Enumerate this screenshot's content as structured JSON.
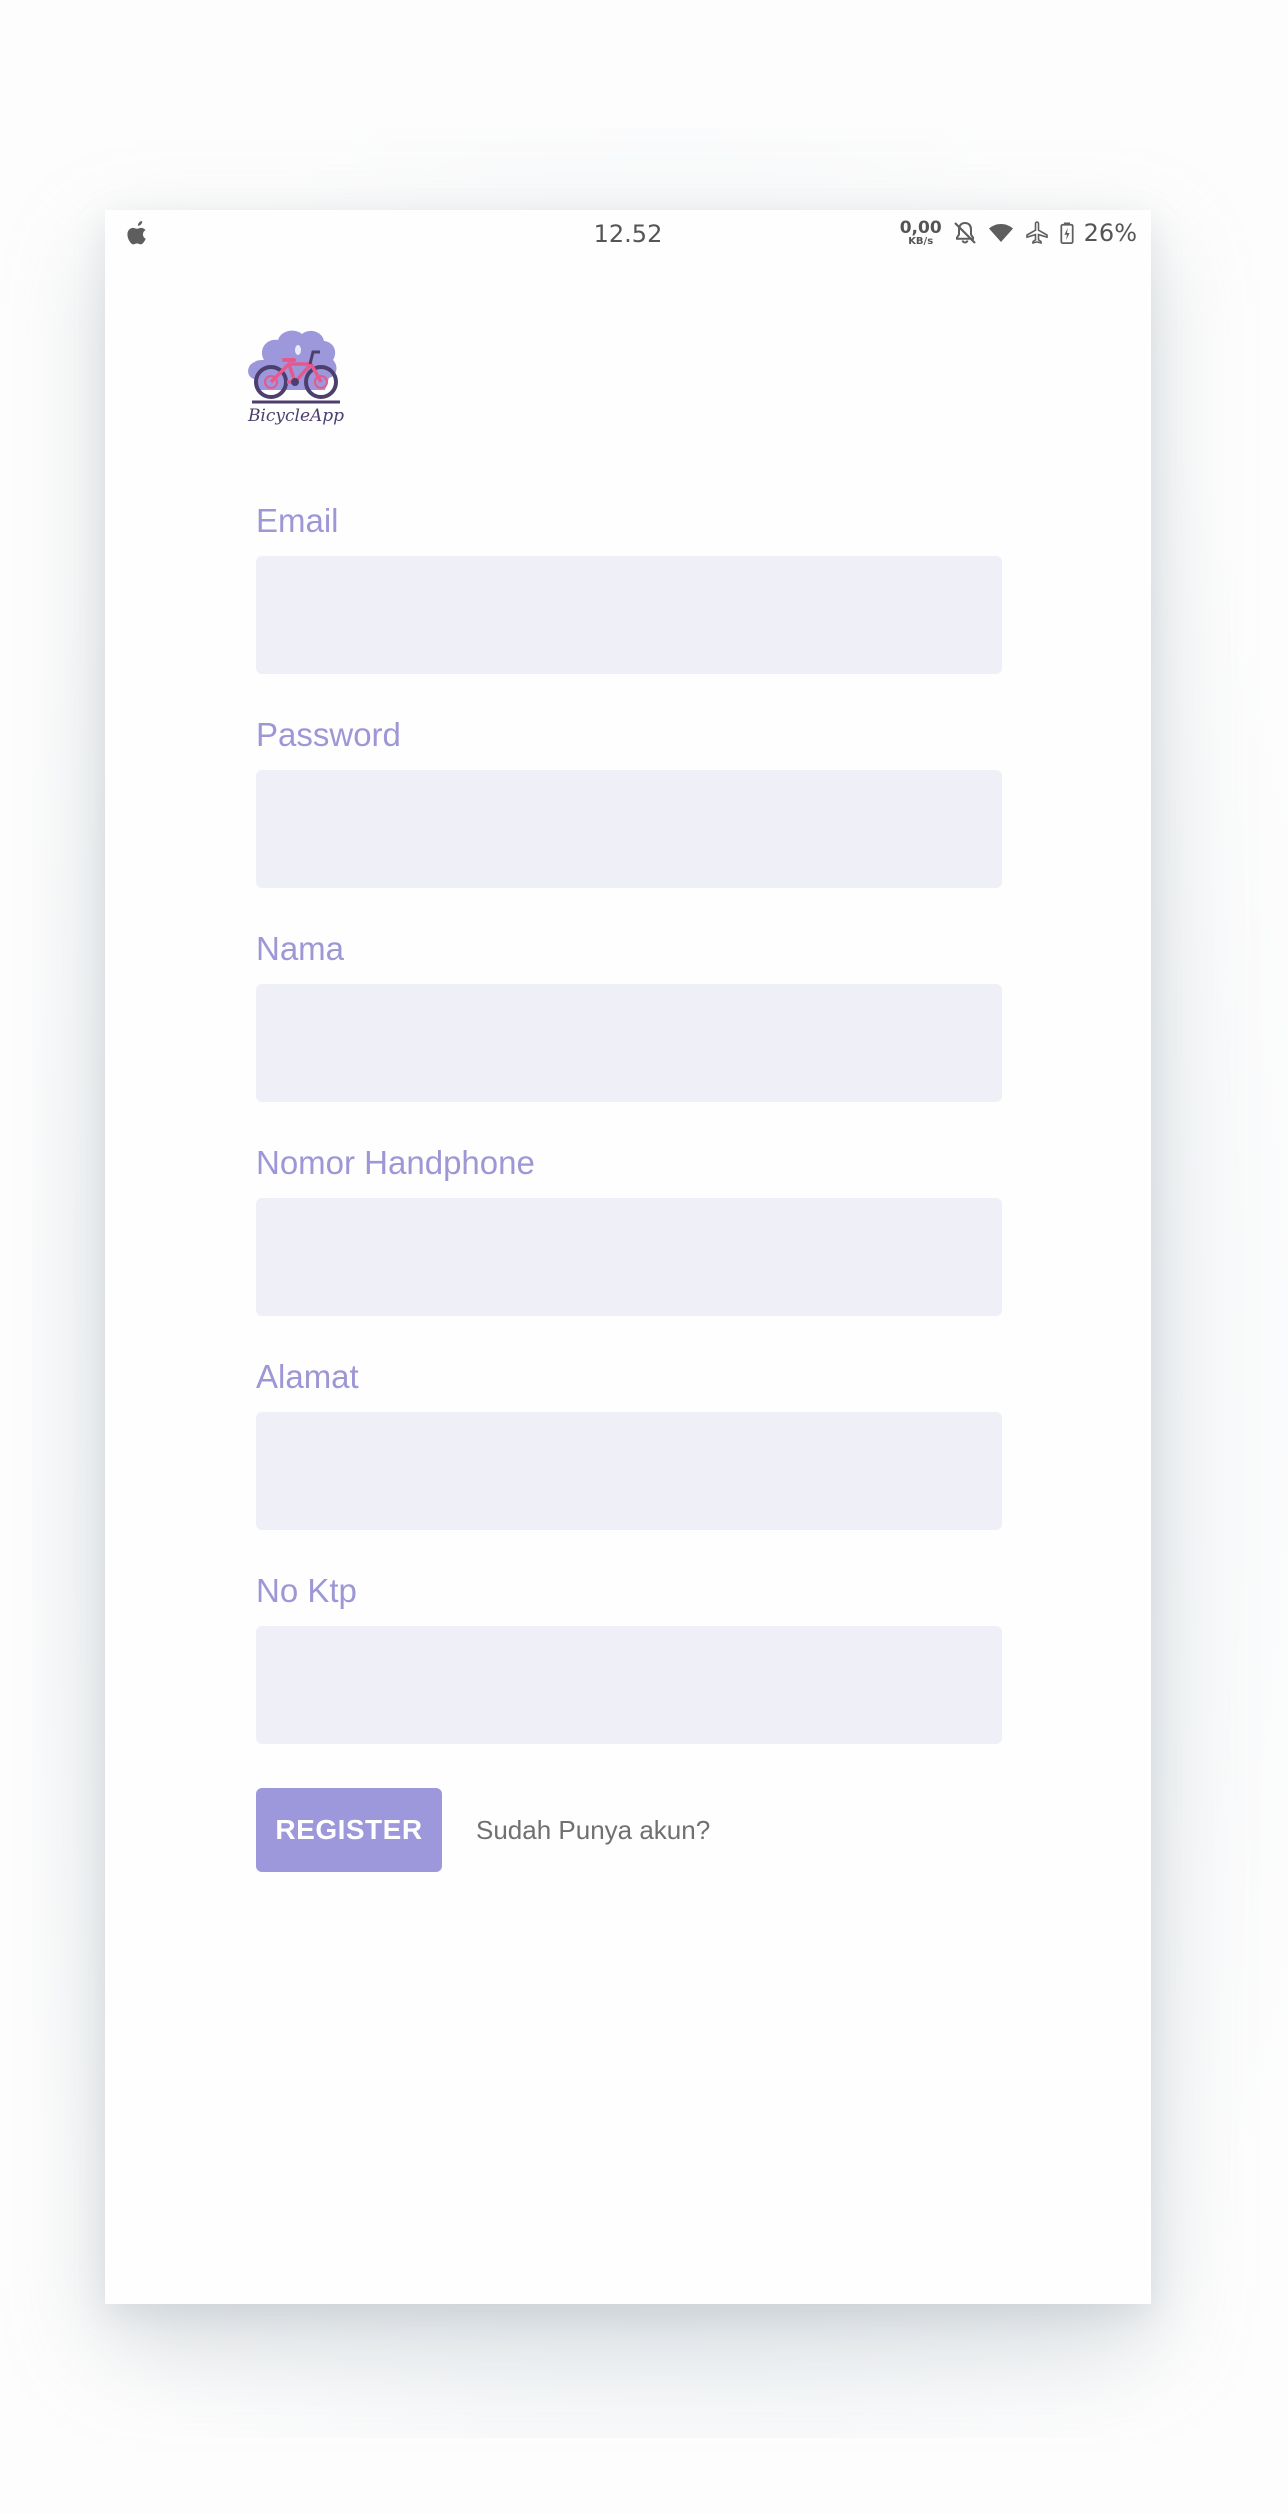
{
  "status_bar": {
    "time": "12.52",
    "net_speed_value": "0,00",
    "net_speed_unit": "KB/s",
    "battery_percent": "26%",
    "icons": [
      "apple-icon",
      "bell-off-icon",
      "wifi-icon",
      "airplane-icon",
      "battery-charging-icon"
    ]
  },
  "logo": {
    "text": "BicycleApp",
    "icon": "bicycle-icon",
    "colors": {
      "blob": "#9d97dc",
      "frame": "#e45a8c",
      "wheel": "#4c3f6e"
    }
  },
  "form": {
    "fields": [
      {
        "label": "Email",
        "value": ""
      },
      {
        "label": "Password",
        "value": ""
      },
      {
        "label": "Nama",
        "value": ""
      },
      {
        "label": "Nomor Handphone",
        "value": ""
      },
      {
        "label": "Alamat",
        "value": ""
      },
      {
        "label": "No Ktp",
        "value": ""
      }
    ],
    "register_label": "REGISTER",
    "login_link_label": "Sudah Punya akun?"
  },
  "colors": {
    "accent": "#9d97dc",
    "label": "#9d97d6",
    "input_bg": "#efeff7",
    "link": "#707070"
  }
}
